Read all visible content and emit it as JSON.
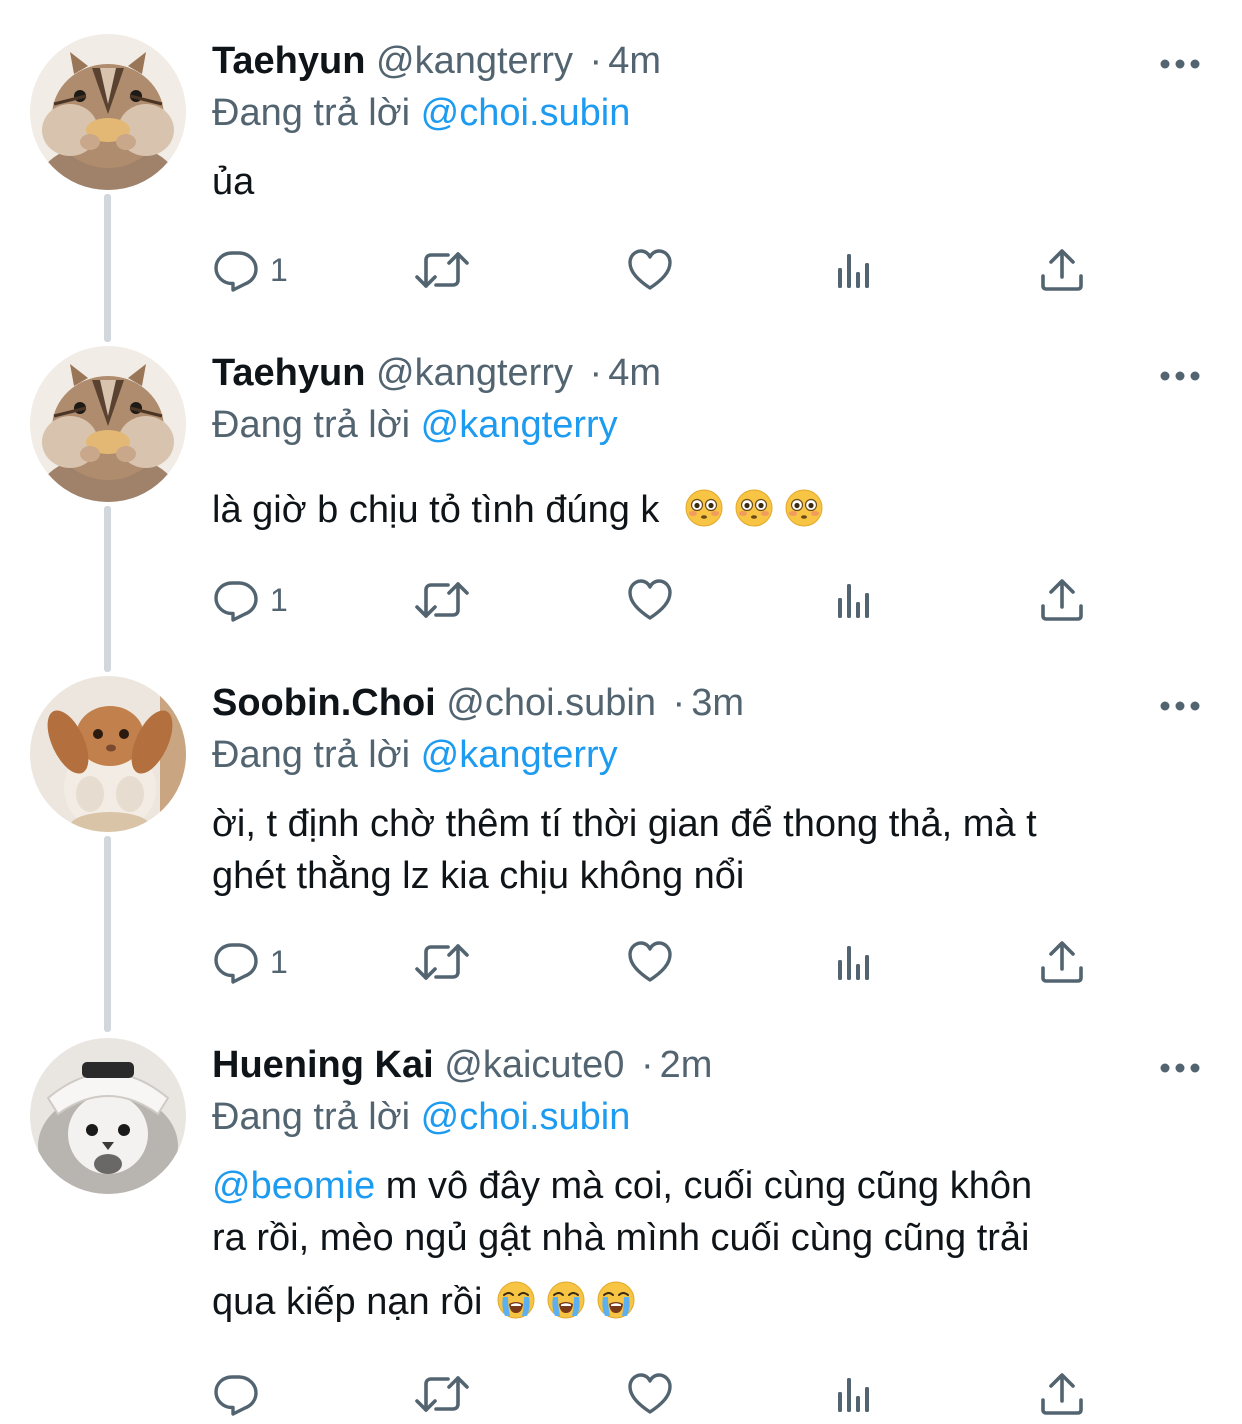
{
  "colors": {
    "link": "#1d9bf0",
    "secondary_text": "#536471",
    "primary_text": "#0f1419",
    "thread_line": "#d1d7dc"
  },
  "tweets": [
    {
      "name": "Taehyun",
      "handle": "@kangterry",
      "separator": "·",
      "time": "4m",
      "replying_prefix": "Đang trả lời",
      "replying_to": "@choi.subin",
      "text": "ủa",
      "reply_count": "1",
      "avatar": "chipmunk-avatar"
    },
    {
      "name": "Taehyun",
      "handle": "@kangterry",
      "separator": "·",
      "time": "4m",
      "replying_prefix": "Đang trả lời",
      "replying_to": "@kangterry",
      "text": "là giờ b chịu tỏ tình đúng k",
      "emojis": [
        "flushed-face",
        "flushed-face",
        "flushed-face"
      ],
      "reply_count": "1",
      "avatar": "chipmunk-avatar"
    },
    {
      "name": "Soobin.Choi",
      "handle": "@choi.subin",
      "separator": "·",
      "time": "3m",
      "replying_prefix": "Đang trả lời",
      "replying_to": "@kangterry",
      "text_line1": "ời, t định chờ thêm tí thời gian để thong thả, mà t",
      "text_line2": "ghét thằng lz kia chịu không nổi",
      "reply_count": "1",
      "avatar": "bunny-avatar"
    },
    {
      "name": "Huening Kai",
      "handle": "@kaicute0",
      "separator": "·",
      "time": "2m",
      "replying_prefix": "Đang trả lời",
      "replying_to": "@choi.subin",
      "mention": "@beomie",
      "text_line1": " m vô đây mà coi, cuối cùng cũng khôn",
      "text_line2": "ra rồi, mèo ngủ gật nhà mình cuối cùng cũng trải",
      "text_line3": "qua kiếp nạn rồi",
      "emojis": [
        "loudly-crying-face",
        "loudly-crying-face",
        "loudly-crying-face"
      ],
      "reply_count": "",
      "avatar": "bird-avatar"
    }
  ],
  "icons": {
    "reply": "reply-icon",
    "retweet": "retweet-icon",
    "like": "heart-icon",
    "views": "analytics-icon",
    "share": "share-icon",
    "more": "more-icon"
  }
}
